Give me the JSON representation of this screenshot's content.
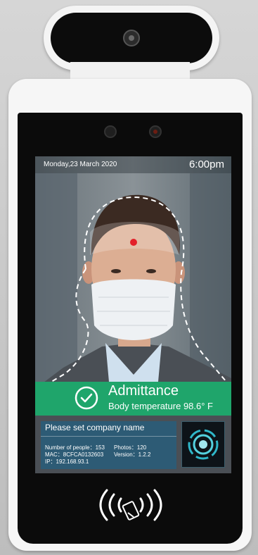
{
  "status_bar": {
    "date": "Monday,23 March 2020",
    "time": "6:00pm"
  },
  "admittance": {
    "title": "Admittance",
    "temperature": "Body temperature 98.6° F",
    "color": "#1fa56b"
  },
  "info_panel": {
    "company": "Please set company name",
    "people": "Number of people：153",
    "photos": "Photos：120",
    "mac": "MAC：8CFCA0132603",
    "version": "Version：1.2.2",
    "ip": "IP：192.168.93.1"
  },
  "icons": {
    "check": "check-circle-icon",
    "face_scan": "face-scan-icon",
    "nfc": "nfc-card-icon",
    "camera": "camera-lens-icon"
  },
  "colors": {
    "accent": "#1fa56b",
    "panel": "#235f82",
    "bezel": "#0b0b0b",
    "shell": "#f6f6f6"
  }
}
